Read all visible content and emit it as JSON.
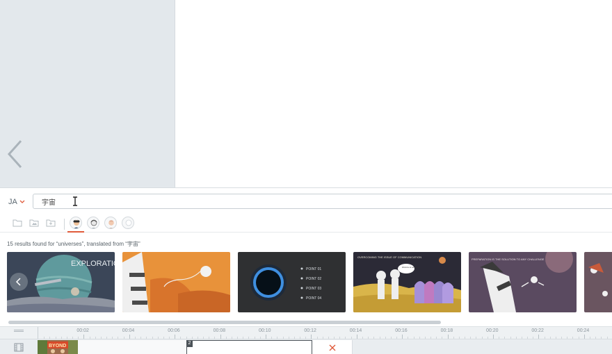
{
  "language": {
    "code": "JA"
  },
  "search": {
    "value": "宇宙",
    "placeholder": ""
  },
  "results": {
    "text": "15 results found for “universes”, translated from “宇宙”"
  },
  "thumbnails": [
    {
      "title": "EXPLORATION"
    },
    {
      "title": ""
    },
    {
      "points": [
        "POINT 01",
        "POINT 02",
        "POINT 03",
        "POINT 04"
      ]
    },
    {
      "title": "OVERCOMING THE ISSUE OF COMMUNICATION",
      "bubble": "Welcome to our planet!"
    },
    {
      "title": "PREPARATION IS THE SOLUTION TO ANY CHALLENGE"
    },
    {
      "title": ""
    }
  ],
  "timeline": {
    "ticks": [
      "00:02",
      "00:04",
      "00:06",
      "00:08",
      "00:10",
      "00:12",
      "00:14",
      "00:16",
      "00:18",
      "00:20",
      "00:22",
      "00:24"
    ],
    "clip_number": "2",
    "clip1_label": "BYOND"
  },
  "icons": {
    "prev": "chevron-left-icon",
    "lang_caret": "chevron-down-icon",
    "folder": "folder-icon",
    "image_folder": "image-folder-icon",
    "add_folder": "add-folder-icon",
    "delete": "close-icon",
    "track": "film-icon"
  },
  "colors": {
    "accent": "#e05a3a",
    "panel": "#e3e8ec"
  }
}
